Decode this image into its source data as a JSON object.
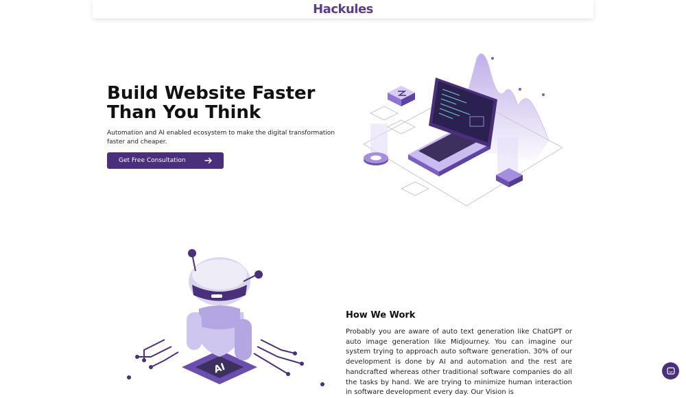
{
  "header": {
    "logo_text": "Hackules"
  },
  "hero": {
    "title": "Build Website Faster Than You Think",
    "subtitle": "Automation and AI enabled ecosystem to make the digital transformation faster and cheaper.",
    "cta_label": "Get Free Consultation"
  },
  "how_we_work": {
    "title": "How We Work",
    "body": "Probably you are aware of auto text generation like ChatGPT or auto image generation like Midjourney. You can imagine our system trying to approach auto software generation. 30% of our development is done by AI and automation and the rest are handcrafted whereas other traditional software companies do all the tasks by hand. We are trying to minimize human interaction in software development every day. Our Vision is"
  },
  "icons": {
    "cta_arrow": "arrow-right-icon",
    "chat": "chat-icon"
  },
  "colors": {
    "brand": "#4a2f7a",
    "accent": "#e0682a",
    "light_purple": "#b9a6e6"
  }
}
